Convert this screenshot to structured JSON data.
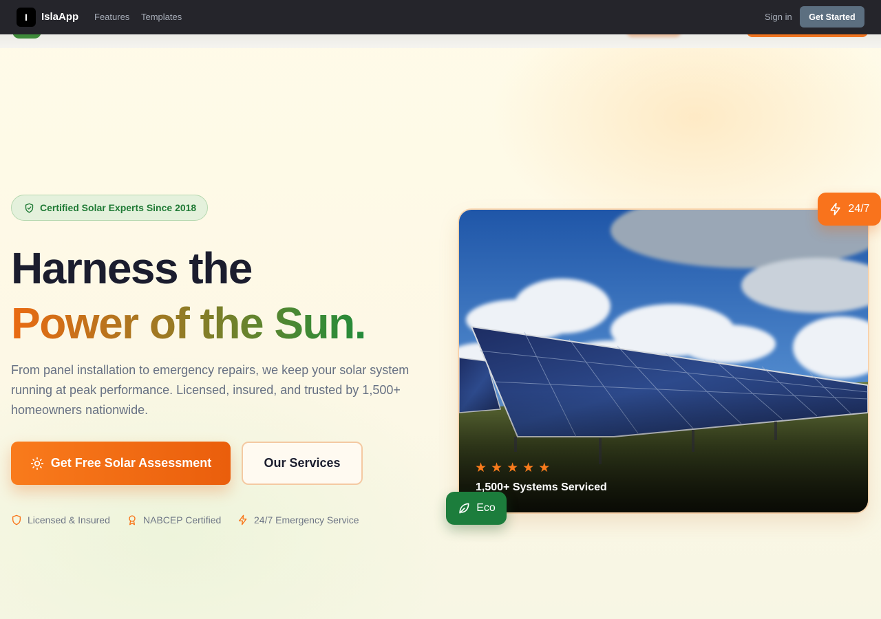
{
  "header": {
    "logo_letter": "I",
    "brand": "IslaApp",
    "nav": [
      "Features",
      "Templates"
    ],
    "sign_in": "Sign in",
    "get_started": "Get Started"
  },
  "hero": {
    "badge": "Certified Solar Experts Since 2018",
    "title_line1": "Harness the",
    "title_line2": "Power of the Sun.",
    "lead": "From panel installation to emergency repairs, we keep your solar system running at peak performance. Licensed, insured, and trusted by 1,500+ homeowners nationwide.",
    "cta_primary": "Get Free Solar Assessment",
    "cta_secondary": "Our Services",
    "trust": [
      "Licensed & Insured",
      "NABCEP Certified",
      "24/7 Emergency Service"
    ]
  },
  "card": {
    "rating": 5,
    "stat": "1,500+ Systems Serviced",
    "pill_top": "24/7",
    "pill_bottom": "Eco"
  },
  "colors": {
    "accent_orange": "#f97316",
    "accent_green": "#1f7a35",
    "heading": "#1b1d2e",
    "muted": "#667083"
  },
  "icons": [
    "shield-check-icon",
    "sun-icon",
    "shield-icon",
    "award-icon",
    "lightning-icon",
    "leaf-icon",
    "star-icon"
  ]
}
